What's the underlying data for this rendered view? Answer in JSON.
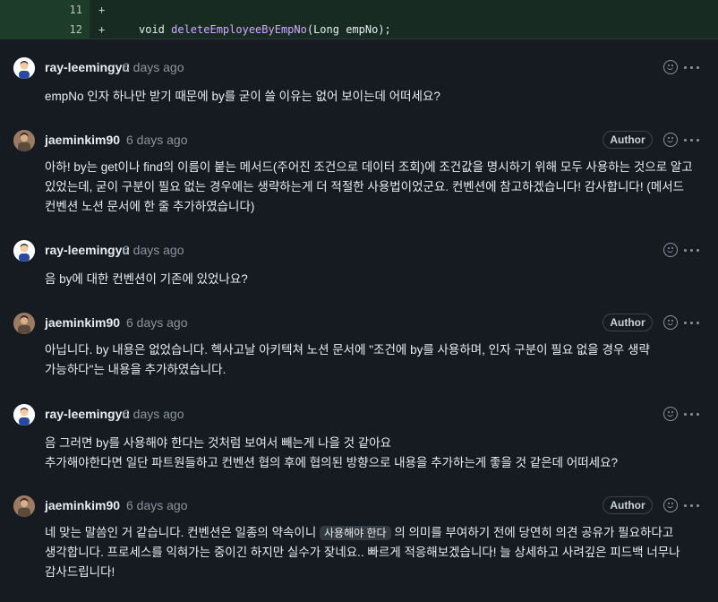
{
  "diff": {
    "lines": [
      {
        "number": "11",
        "sign": "+",
        "code": ""
      },
      {
        "number": "12",
        "sign": "+",
        "code_kw": "void ",
        "code_fn": "deleteEmployeeByEmpNo",
        "code_rest": "(Long empNo);"
      }
    ]
  },
  "comments": [
    {
      "author": "ray-leemingyu",
      "time": "6 days ago",
      "badge": "",
      "body": "empNo 인자 하나만 받기 때문에 by를 굳이 쓸 이유는 없어 보이는데 어떠세요?"
    },
    {
      "author": "jaeminkim90",
      "time": "6 days ago",
      "badge": "Author",
      "body": "아하! by는 get이나 find의 이름이 붙는 메서드(주어진 조건으로 데이터 조회)에 조건값을 명시하기 위해 모두 사용하는 것으로 알고 있었는데, 굳이 구분이 필요 없는 경우에는 생략하는게 더 적절한 사용법이었군요. 컨벤션에 참고하겠습니다! 감사합니다! (메서드 컨벤션 노션 문서에 한 줄 추가하였습니다)"
    },
    {
      "author": "ray-leemingyu",
      "time": "6 days ago",
      "badge": "",
      "body": "음 by에 대한 컨벤션이 기존에 있었나요?"
    },
    {
      "author": "jaeminkim90",
      "time": "6 days ago",
      "badge": "Author",
      "body": "아닙니다. by 내용은 없었습니다. 헥사고날 아키텍쳐 노션 문서에 \"조건에 by를 사용하며, 인자 구분이 필요 없을 경우 생략 가능하다\"는 내용을 추가하였습니다."
    },
    {
      "author": "ray-leemingyu",
      "time": "6 days ago",
      "badge": "",
      "body_line1": "음 그러면 by를 사용해야 한다는 것처럼 보여서 빼는게 나을 것 같아요",
      "body_line2": "추가해야한다면 일단 파트원들하고 컨벤션 협의 후에 협의된 방향으로 내용을 추가하는게 좋을 것 같은데 어떠세요?"
    },
    {
      "author": "jaeminkim90",
      "time": "6 days ago",
      "badge": "Author",
      "body_pre": "네 맞는 말씀인 거 같습니다. 컨벤션은 일종의 약속이니 ",
      "body_code": "사용해야 한다",
      "body_post": " 의 의미를 부여하기 전에 당연히 의견 공유가 필요하다고 생각합니다. 프로세스를 익혀가는 중이긴 하지만 실수가 잦네요.. 빠르게 적응해보겠습니다! 늘 상세하고 사려깊은 피드백 너무나 감사드립니다!"
    }
  ]
}
